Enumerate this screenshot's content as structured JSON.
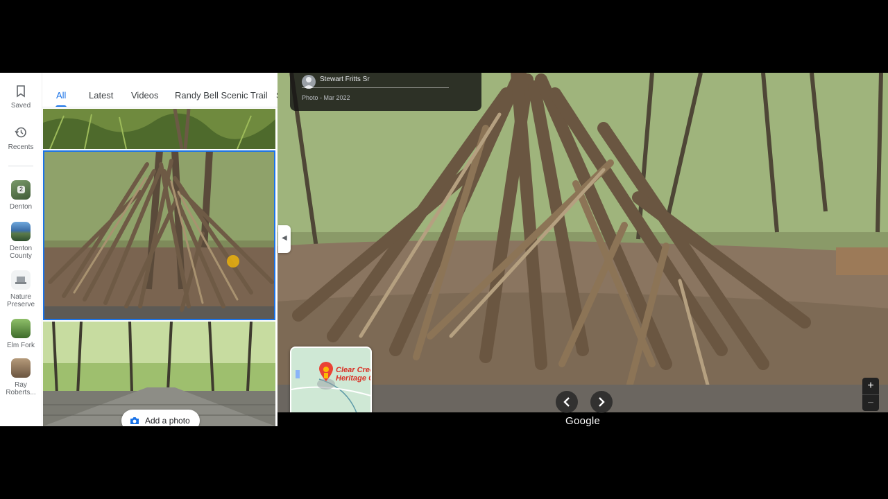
{
  "rail": {
    "saved_label": "Saved",
    "recents_label": "Recents",
    "places": [
      {
        "label": "Denton",
        "badge": "2"
      },
      {
        "label": "Denton County",
        "badge": ""
      },
      {
        "label": "Nature Preserve",
        "badge": ""
      },
      {
        "label": "Elm Fork",
        "badge": ""
      },
      {
        "label": "Ray Roberts...",
        "badge": ""
      }
    ]
  },
  "tabs": [
    "All",
    "Latest",
    "Videos",
    "Randy Bell Scenic Trail",
    "S"
  ],
  "active_tab": "All",
  "add_photo_label": "Add a photo",
  "photo_info": {
    "author": "Stewart Fritts Sr",
    "date": "Photo - Mar 2022"
  },
  "minimap": {
    "place_label_line1": "Clear Cree",
    "place_label_line2": "Heritage C"
  },
  "viewer": {
    "prev_icon": "chevron-left-icon",
    "next_icon": "chevron-right-icon",
    "attribution": "Google",
    "zoom_in": "+",
    "zoom_out": "−"
  },
  "colors": {
    "accent": "#1a73e8",
    "pin": "#ea4335"
  }
}
